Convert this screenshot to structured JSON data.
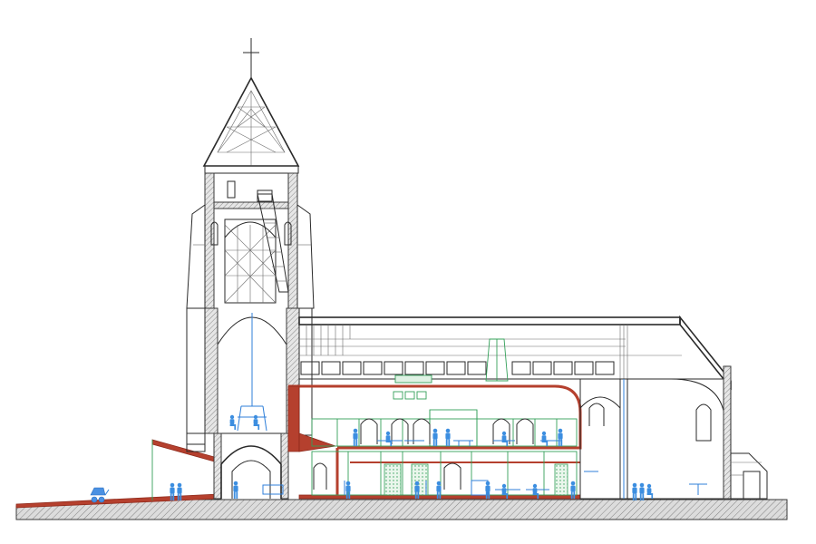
{
  "drawing": {
    "kind": "architectural-section",
    "subject": "church-with-bell-tower",
    "colors": {
      "structure": "#2a2a2a",
      "cut_walls_hatch": "#3a3a3a",
      "new_slab": "#b5402e",
      "glazing_partitions": "#34a05a",
      "people_furniture": "#3c8ee0",
      "background": "#ffffff"
    },
    "icons": [
      "cross-icon",
      "person-icon",
      "stroller-icon",
      "tree-icon",
      "car-icon"
    ]
  }
}
